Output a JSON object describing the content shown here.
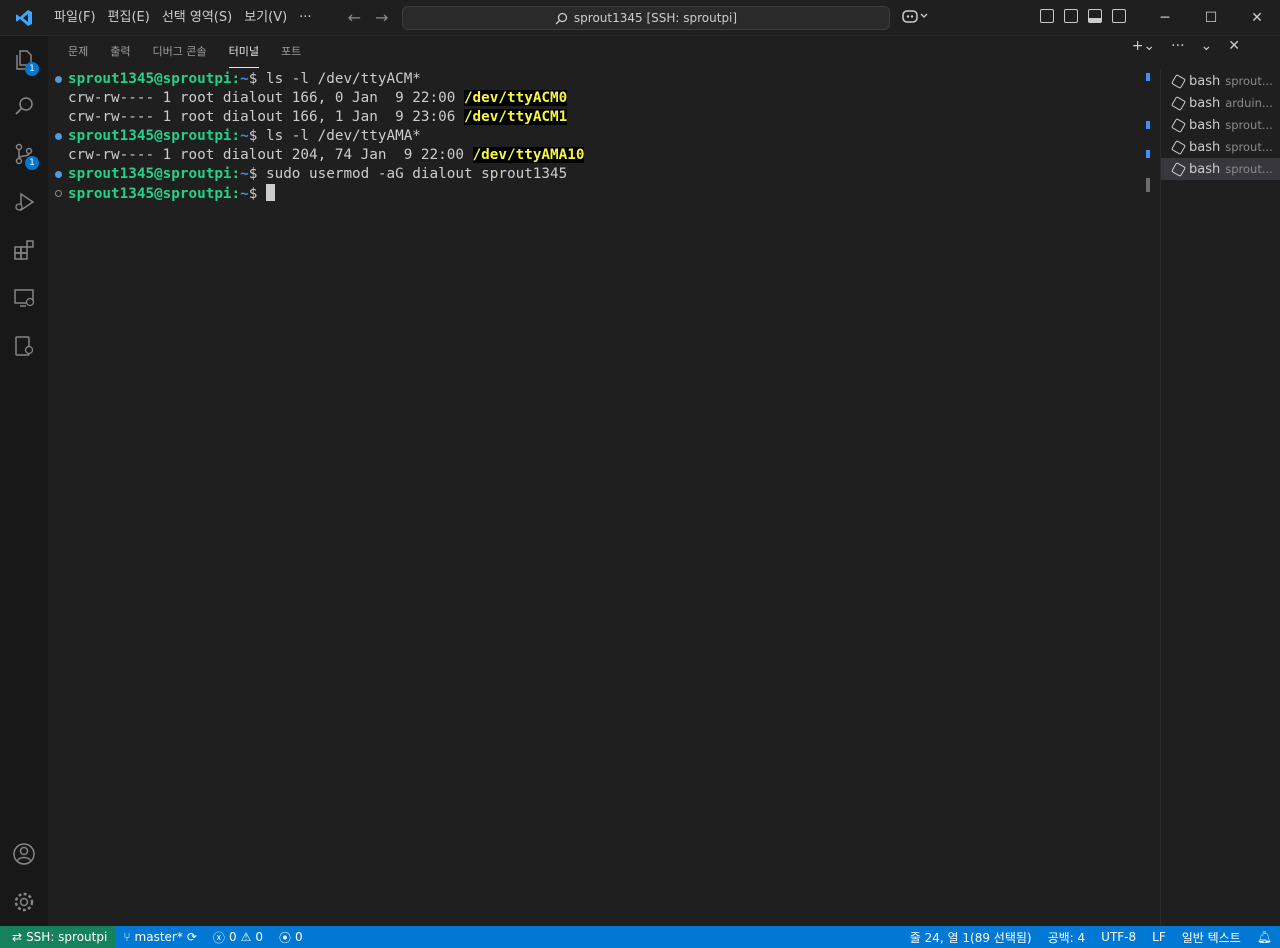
{
  "menu": [
    "파일(F)",
    "편집(E)",
    "선택 영역(S)",
    "보기(V)",
    "···"
  ],
  "search": {
    "text": "sprout1345 [SSH: sproutpi]"
  },
  "activity_badges": {
    "explorer": "1",
    "scm": "1"
  },
  "panel": {
    "tabs": [
      "문제",
      "출력",
      "디버그 콘솔",
      "터미널",
      "포트"
    ],
    "active_tab": "터미널"
  },
  "terminal": {
    "l1_user": "sprout1345@sproutpi",
    "l1_tilde": "~",
    "l1_cmd": "$ ls -l /dev/ttyACM*",
    "l2_text": "crw-rw---- 1 root dialout 166, 0 Jan  9 22:00 ",
    "l2_hl": "/dev/ttyACM0",
    "l3_text": "crw-rw---- 1 root dialout 166, 1 Jan  9 23:06 ",
    "l3_hl": "/dev/ttyACM1",
    "l4_user": "sprout1345@sproutpi",
    "l4_tilde": "~",
    "l4_cmd": "$ ls -l /dev/ttyAMA*",
    "l5_text": "crw-rw---- 1 root dialout 204, 74 Jan  9 22:00 ",
    "l5_hl": "/dev/ttyAMA10",
    "l6_user": "sprout1345@sproutpi",
    "l6_tilde": "~",
    "l6_cmd": "$ sudo usermod -aG dialout sprout1345",
    "l7_user": "sprout1345@sproutpi",
    "l7_tilde": "~",
    "l7_cmd": "$ ",
    "colon": ":"
  },
  "terminals": [
    {
      "name": "bash",
      "sub": "sprout..."
    },
    {
      "name": "bash",
      "sub": "arduin..."
    },
    {
      "name": "bash",
      "sub": "sprout..."
    },
    {
      "name": "bash",
      "sub": "sprout..."
    },
    {
      "name": "bash",
      "sub": "sprout..."
    }
  ],
  "status": {
    "remote": "SSH: sproutpi",
    "branch": "master*",
    "errors": "0",
    "warnings": "0",
    "ports": "0",
    "position": "줄 24, 열 1(89 선택됨)",
    "spaces": "공백: 4",
    "encoding": "UTF-8",
    "eol": "LF",
    "language": "일반 텍스트"
  },
  "colors": {
    "accent": "#0078d4",
    "remote": "#16825d",
    "prompt_user": "#23d18b",
    "prompt_path": "#3b8eea",
    "highlight": "#f5f543"
  }
}
